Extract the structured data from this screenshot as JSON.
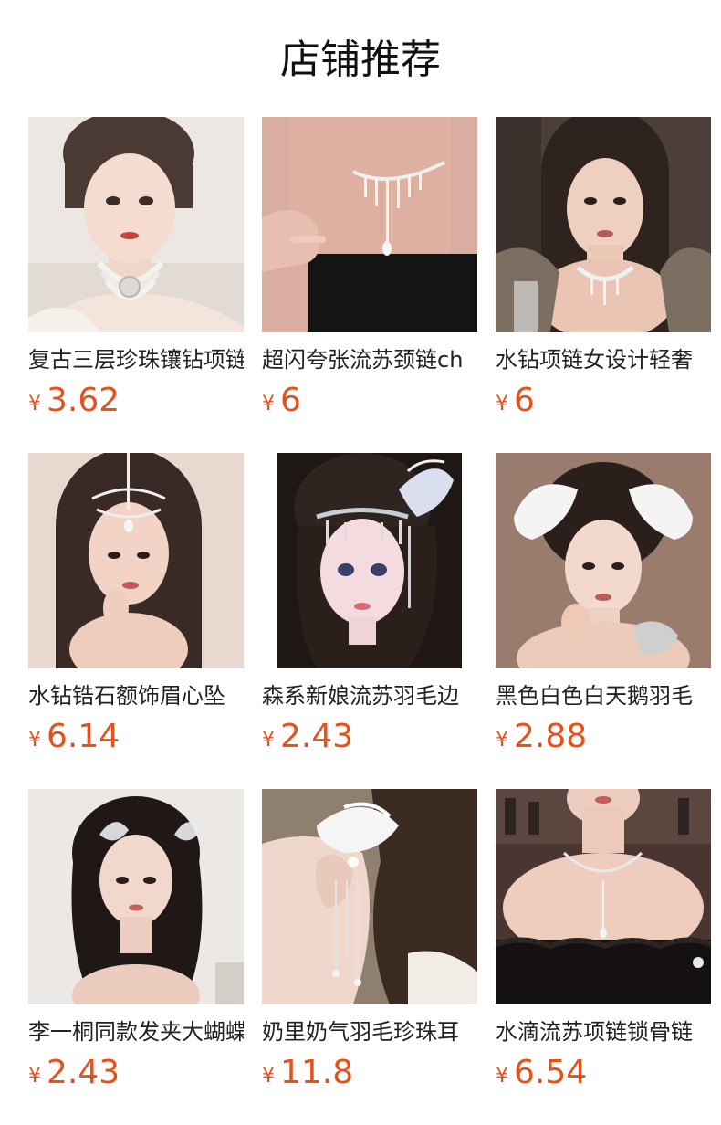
{
  "header": {
    "title": "店铺推荐"
  },
  "currency_symbol": "¥",
  "products": [
    {
      "name": "复古三层珍珠镶钻项链",
      "price": "3.62"
    },
    {
      "name": "超闪夸张流苏颈链ch",
      "price": "6"
    },
    {
      "name": "水钻项链女设计轻奢",
      "price": "6"
    },
    {
      "name": "水钻锆石额饰眉心坠",
      "price": "6.14"
    },
    {
      "name": "森系新娘流苏羽毛边",
      "price": "2.43"
    },
    {
      "name": "黑色白色白天鹅羽毛",
      "price": "2.88"
    },
    {
      "name": "李一桐同款发夹大蝴蝶",
      "price": "2.43"
    },
    {
      "name": "奶里奶气羽毛珍珠耳",
      "price": "11.8"
    },
    {
      "name": "水滴流苏项链锁骨链",
      "price": "6.54"
    }
  ]
}
